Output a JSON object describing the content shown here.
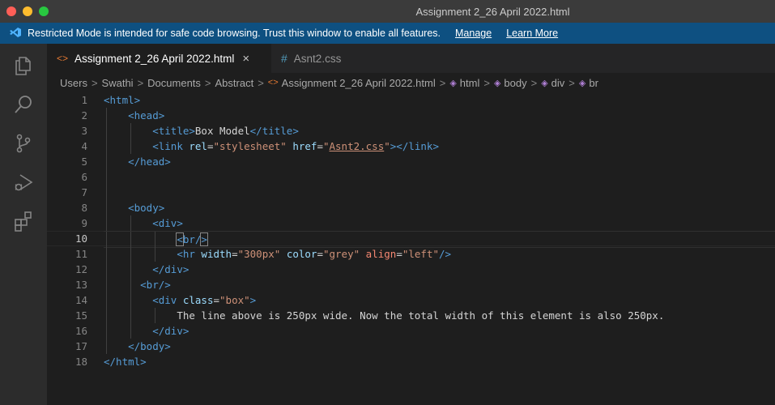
{
  "window": {
    "title": "Assignment 2_26 April 2022.html"
  },
  "banner": {
    "message": "Restricted Mode is intended for safe code browsing. Trust this window to enable all features.",
    "manage_label": "Manage",
    "learn_more_label": "Learn More"
  },
  "activity_bar": {
    "icons": [
      "files-icon",
      "search-icon",
      "source-control-icon",
      "run-debug-icon",
      "extensions-icon"
    ]
  },
  "tabs": [
    {
      "label": "Assignment 2_26 April 2022.html",
      "close": "×",
      "icon": "<>"
    },
    {
      "label": "Asnt2.css",
      "icon": "#"
    }
  ],
  "breadcrumbs": {
    "users": "Users",
    "swathi": "Swathi",
    "documents": "Documents",
    "abstract": "Abstract",
    "file": "Assignment 2_26 April 2022.html",
    "html": "html",
    "body": "body",
    "div": "div",
    "br": "br",
    "sep": ">"
  },
  "editor": {
    "current_line": 10,
    "lines": [
      {
        "n": "1"
      },
      {
        "n": "2"
      },
      {
        "n": "3"
      },
      {
        "n": "4"
      },
      {
        "n": "5"
      },
      {
        "n": "6"
      },
      {
        "n": "7"
      },
      {
        "n": "8"
      },
      {
        "n": "9"
      },
      {
        "n": "10"
      },
      {
        "n": "11"
      },
      {
        "n": "12"
      },
      {
        "n": "13"
      },
      {
        "n": "14"
      },
      {
        "n": "15"
      },
      {
        "n": "16"
      },
      {
        "n": "17"
      },
      {
        "n": "18"
      }
    ],
    "code": {
      "l1": "<html>",
      "l2": "<head>",
      "l3_open": "<title>",
      "l3_text": "Box Model",
      "l3_close": "</title>",
      "l4_open": "<link ",
      "l4_rel_attr": "rel",
      "l4_rel_val": "\"stylesheet\"",
      "l4_href_attr": "href",
      "l4_href_q1": "\"",
      "l4_href_val": "Asnt2.css",
      "l4_href_q2": "\"",
      "l4_close": "></link>",
      "l5": "</head>",
      "l8": "<body>",
      "l9": "<div>",
      "l10_lt": "<",
      "l10_mid": "br/",
      "l10_gt": ">",
      "l11_open": "<hr ",
      "l11_width_attr": "width",
      "l11_width_val": "\"300px\"",
      "l11_color_attr": "color",
      "l11_color_val": "\"grey\"",
      "l11_align_attr": "align",
      "l11_align_val": "\"left\"",
      "l11_close": "/>",
      "l12": "</div>",
      "l13": "<br/>",
      "l14_open": "<div ",
      "l14_class_attr": "class",
      "l14_class_val": "\"box\"",
      "l14_close": ">",
      "l15_text": "The line above is 250px wide. Now the total width of this element is also 250px.",
      "l16": "</div>",
      "l17": "</body>",
      "l18": "</html>"
    }
  },
  "colors": {
    "tag": "#569cd6",
    "attribute": "#9cdcfe",
    "string": "#ce9178",
    "banner": "#0e5081"
  }
}
